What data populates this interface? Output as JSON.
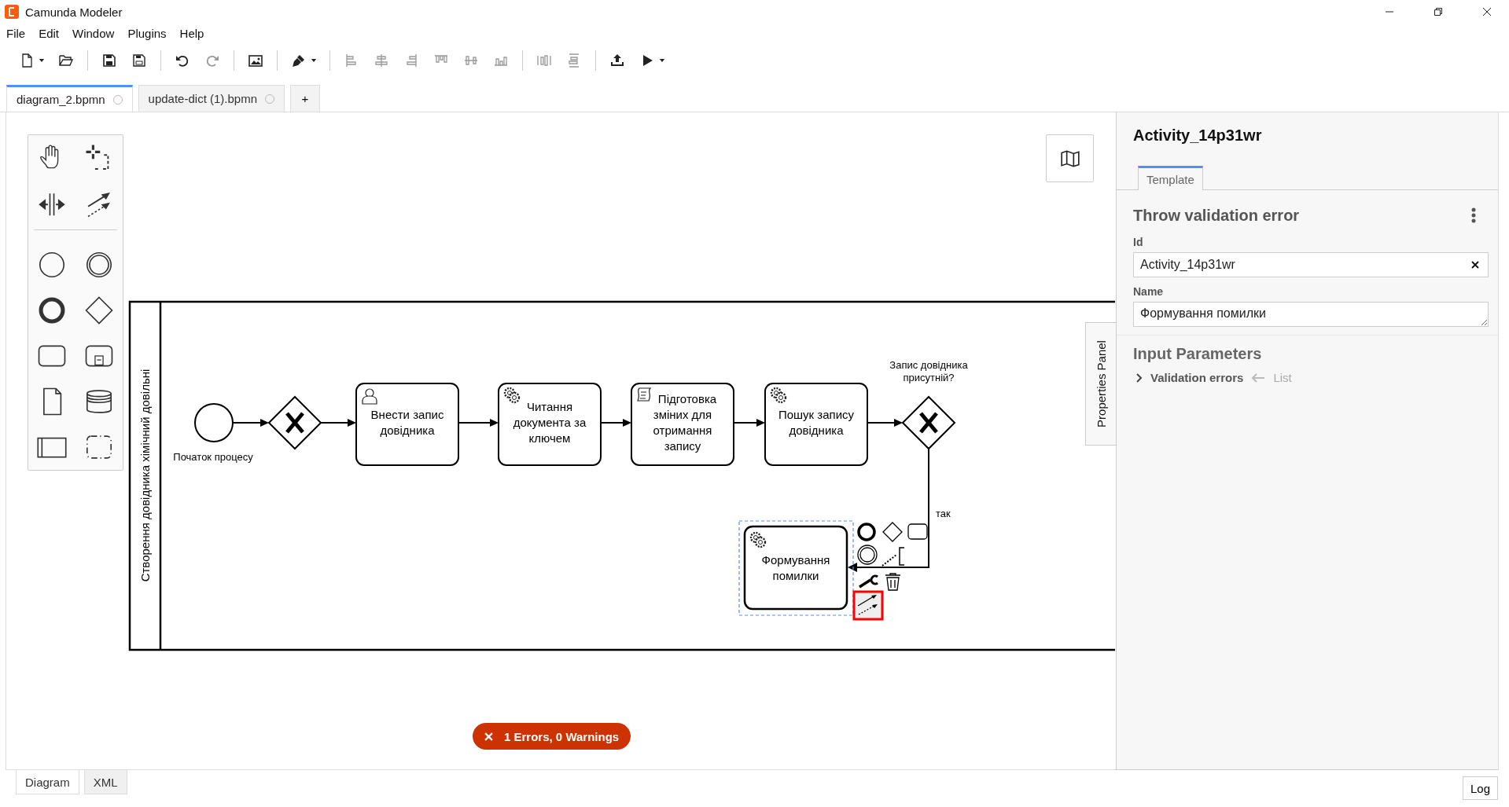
{
  "window": {
    "title": "Camunda Modeler"
  },
  "menu": [
    "File",
    "Edit",
    "Window",
    "Plugins",
    "Help"
  ],
  "file_tabs": [
    {
      "label": "diagram_2.bpmn",
      "selected": true
    },
    {
      "label": "update-dict (1).bpmn",
      "selected": false
    }
  ],
  "new_tab": "+",
  "diagram": {
    "lane_label": "Створення довідника хімічний довільні",
    "start_label": "Початок процесу",
    "tasks": [
      {
        "kind": "user",
        "lines": [
          "Внести запис",
          "довідника"
        ]
      },
      {
        "kind": "service",
        "lines": [
          "Читання",
          "документа за",
          "ключем"
        ]
      },
      {
        "kind": "script",
        "lines": [
          "Підготовка",
          "зміних для",
          "отримання",
          "запису"
        ]
      },
      {
        "kind": "service",
        "lines": [
          "Пошук запису",
          "довідника"
        ]
      }
    ],
    "gateway_label": [
      "Запис довідника",
      "присутній?"
    ],
    "flow_label": "так",
    "selected_task": {
      "kind": "service",
      "lines": [
        "Формування",
        "помилки"
      ],
      "selected": true
    }
  },
  "validation": {
    "text": "1 Errors, 0 Warnings"
  },
  "properties_toggle": "Properties Panel",
  "properties": {
    "title": "Activity_14p31wr",
    "tabs": [
      {
        "label": "Template",
        "selected": true
      }
    ],
    "group_title": "Throw validation error",
    "fields": [
      {
        "kind": "input",
        "label": "Id",
        "value": "Activity_14p31wr"
      },
      {
        "kind": "textarea",
        "label": "Name",
        "value": "Формування помилки"
      }
    ],
    "section_title": "Input Parameters",
    "params": [
      {
        "label": "Validation errors",
        "type": "List",
        "expanded": false
      }
    ]
  },
  "view_tabs": [
    {
      "label": "Diagram",
      "selected": true
    },
    {
      "label": "XML",
      "selected": false
    }
  ],
  "log_button": "Log"
}
